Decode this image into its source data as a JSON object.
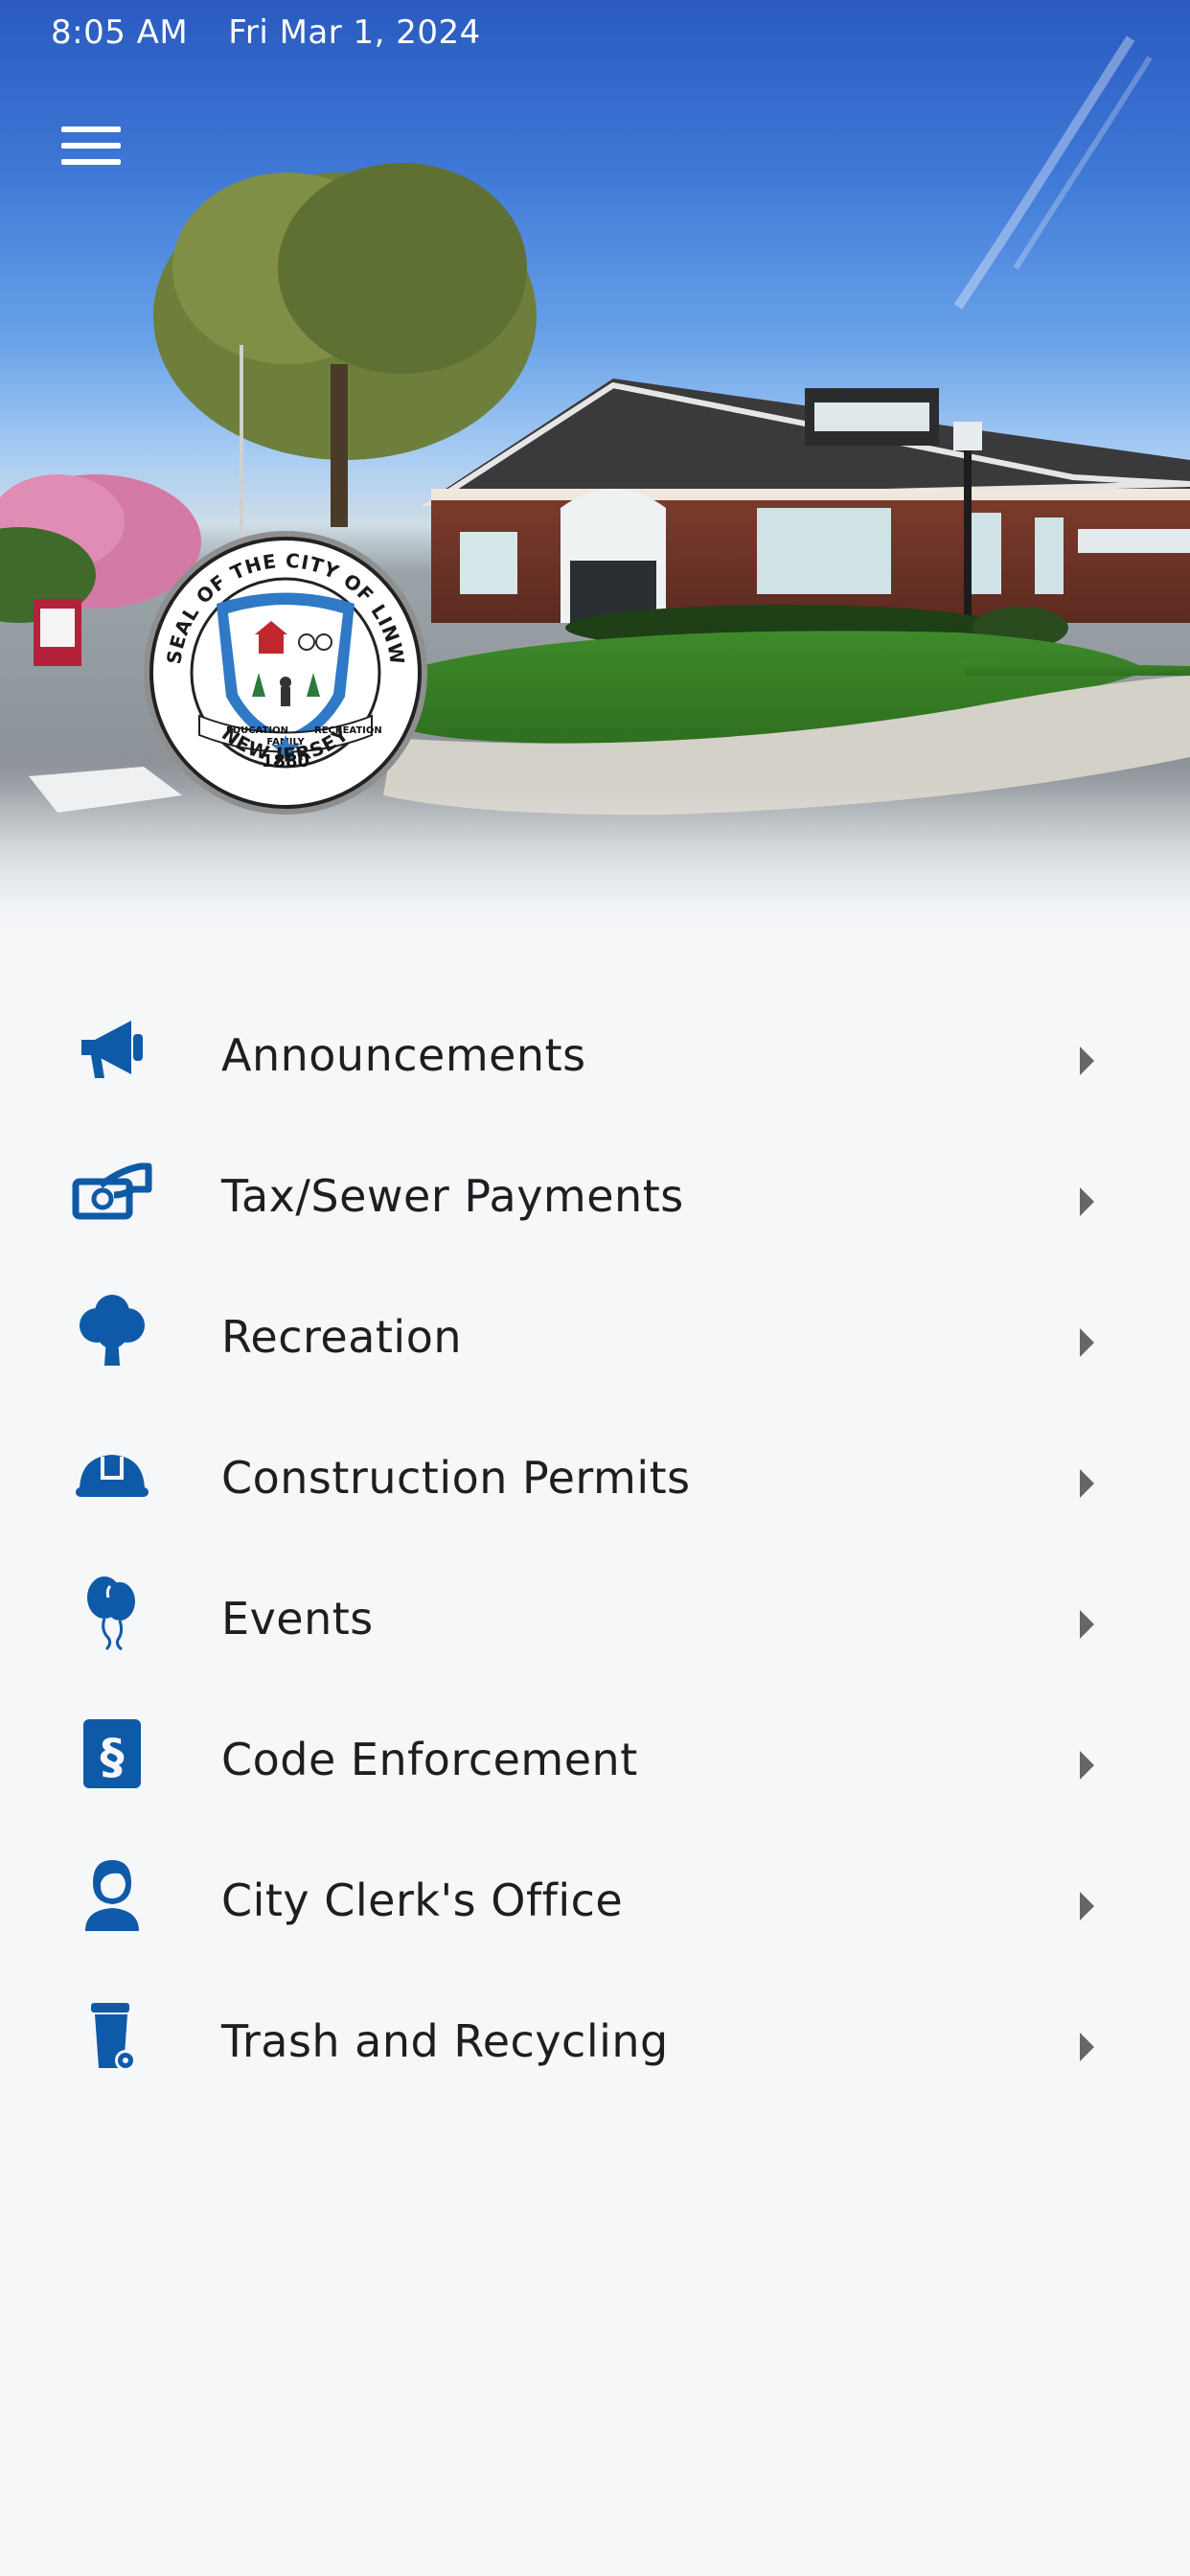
{
  "status": {
    "time": "8:05 AM",
    "date": "Fri Mar 1, 2024"
  },
  "header": {
    "menu_icon": "hamburger-menu-icon"
  },
  "seal": {
    "arc_text": "THE SEAL OF THE CITY OF LINWOOD",
    "motto_left": "EDUCATION",
    "motto_center": "FAMILY",
    "motto_right": "RECREATION",
    "year": "1880",
    "state": "NEW JERSEY"
  },
  "menu": {
    "items": [
      {
        "label": "Announcements",
        "icon": "megaphone-icon"
      },
      {
        "label": "Tax/Sewer Payments",
        "icon": "money-payment-icon"
      },
      {
        "label": "Recreation",
        "icon": "tree-icon"
      },
      {
        "label": "Construction Permits",
        "icon": "hard-hat-icon"
      },
      {
        "label": "Events",
        "icon": "balloons-icon"
      },
      {
        "label": "Code Enforcement",
        "icon": "law-section-icon"
      },
      {
        "label": "City Clerk's Office",
        "icon": "clerk-person-icon"
      },
      {
        "label": "Trash and Recycling",
        "icon": "trash-bin-icon"
      }
    ]
  },
  "colors": {
    "icon_blue": "#0f5aa8",
    "text": "#1e1e1e",
    "chevron": "#666666",
    "background": "#f5f7f9"
  }
}
